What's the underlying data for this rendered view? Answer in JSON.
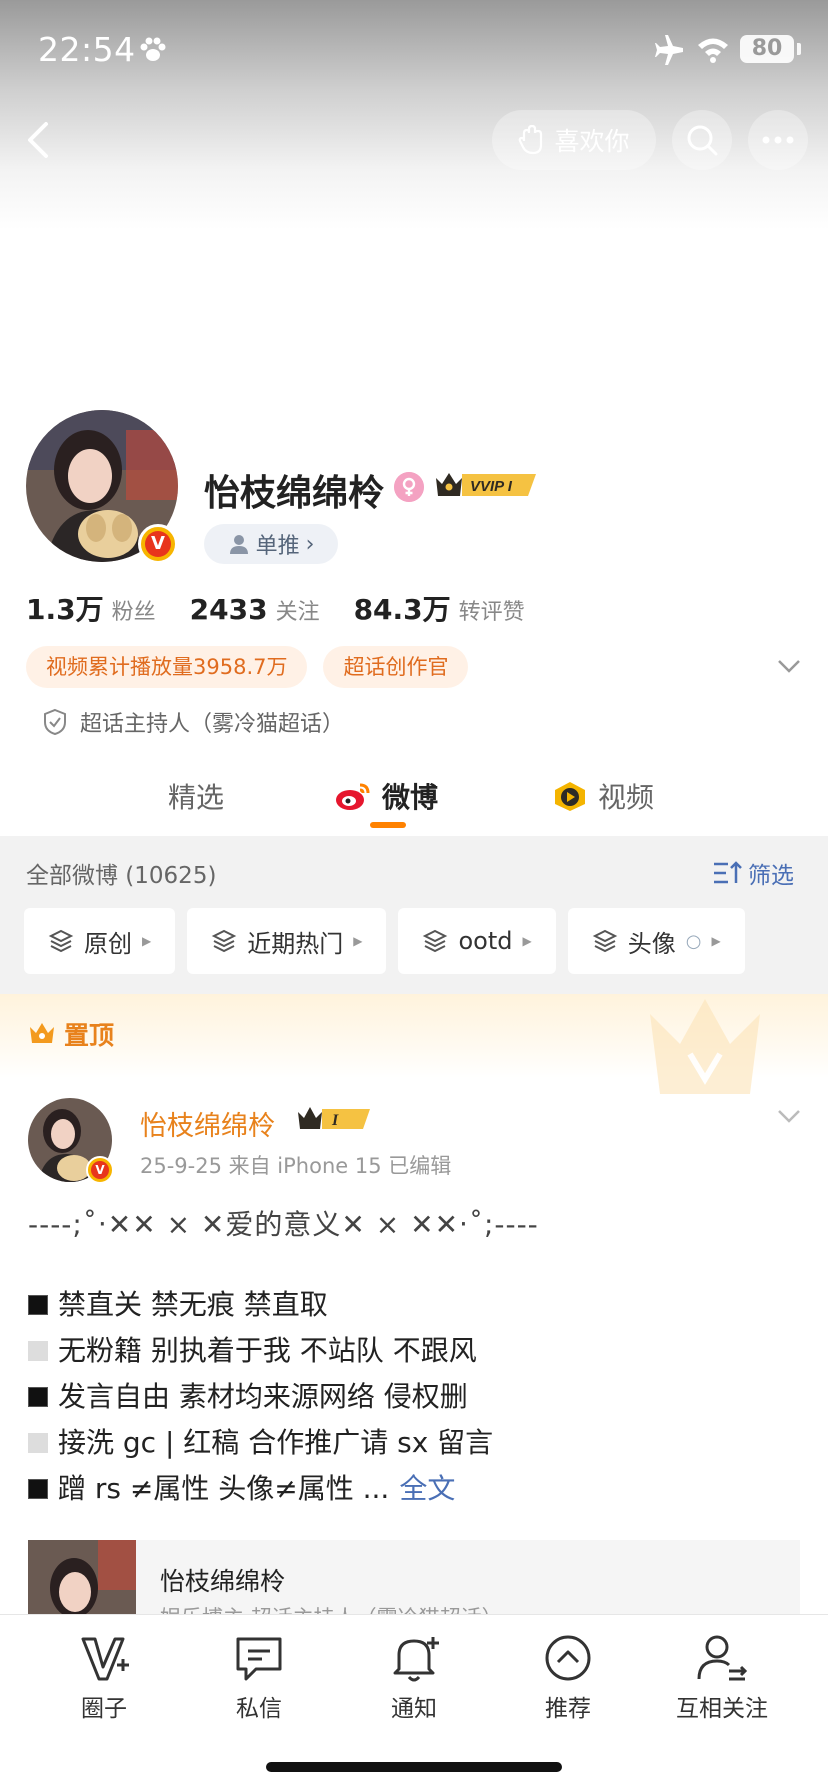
{
  "status_bar": {
    "time": "22:54",
    "battery": "80"
  },
  "header": {
    "like_label": "喜欢你"
  },
  "profile": {
    "name": "怡枝绵绵柃",
    "vip_text": "VVIP I",
    "fan_tag": "单推",
    "stats": [
      {
        "num": "1.3万",
        "label": "粉丝"
      },
      {
        "num": "2433",
        "label": "关注"
      },
      {
        "num": "84.3万",
        "label": "转评赞"
      }
    ],
    "tags": [
      "视频累计播放量3958.7万",
      "超话创作官"
    ],
    "host_line": "超话主持人（雾冷猫超话）"
  },
  "tabs": [
    {
      "label": "精选",
      "active": false
    },
    {
      "label": "微博",
      "active": true
    },
    {
      "label": "视频",
      "active": false
    }
  ],
  "filter": {
    "all_count": "全部微博 (10625)",
    "filter_label": "筛选",
    "chips": [
      "原创",
      "近期热门",
      "ootd",
      "头像"
    ]
  },
  "pinned": {
    "label": "置顶",
    "author": "怡枝绵绵柃",
    "meta": "25-9-25  来自 iPhone 15  已编辑",
    "deco_line": "----;˚‧✕✕ ⨯ ✕爱的意义✕ ⨯ ✕✕‧˚;----",
    "lines": [
      {
        "style": "black",
        "text": "禁直关  禁无痕  禁直取"
      },
      {
        "style": "gray",
        "text": "无粉籍 别执着于我 不站队 不跟风"
      },
      {
        "style": "black",
        "text": "发言自由 素材均来源网络 侵权删"
      },
      {
        "style": "gray",
        "text": "接洗 gc | 红稿  合作推广请 sx 留言"
      },
      {
        "style": "black",
        "text": "蹭 rs ≠属性 头像≠属性 ... "
      }
    ],
    "fulltext_label": "全文",
    "repost_name": "怡枝绵绵柃",
    "repost_sub": "娱乐博主 超话主持人（雾冷猫超话）"
  },
  "bottom_nav": [
    {
      "label": "圈子",
      "icon": "circle-v-icon"
    },
    {
      "label": "私信",
      "icon": "chat-icon"
    },
    {
      "label": "通知",
      "icon": "bell-icon"
    },
    {
      "label": "推荐",
      "icon": "up-arrow-circle-icon"
    },
    {
      "label": "互相关注",
      "icon": "mutual-follow-icon"
    }
  ],
  "colors": {
    "accent": "#ff8200",
    "link": "#4a6fb5",
    "orange_text": "#e06c1f"
  }
}
